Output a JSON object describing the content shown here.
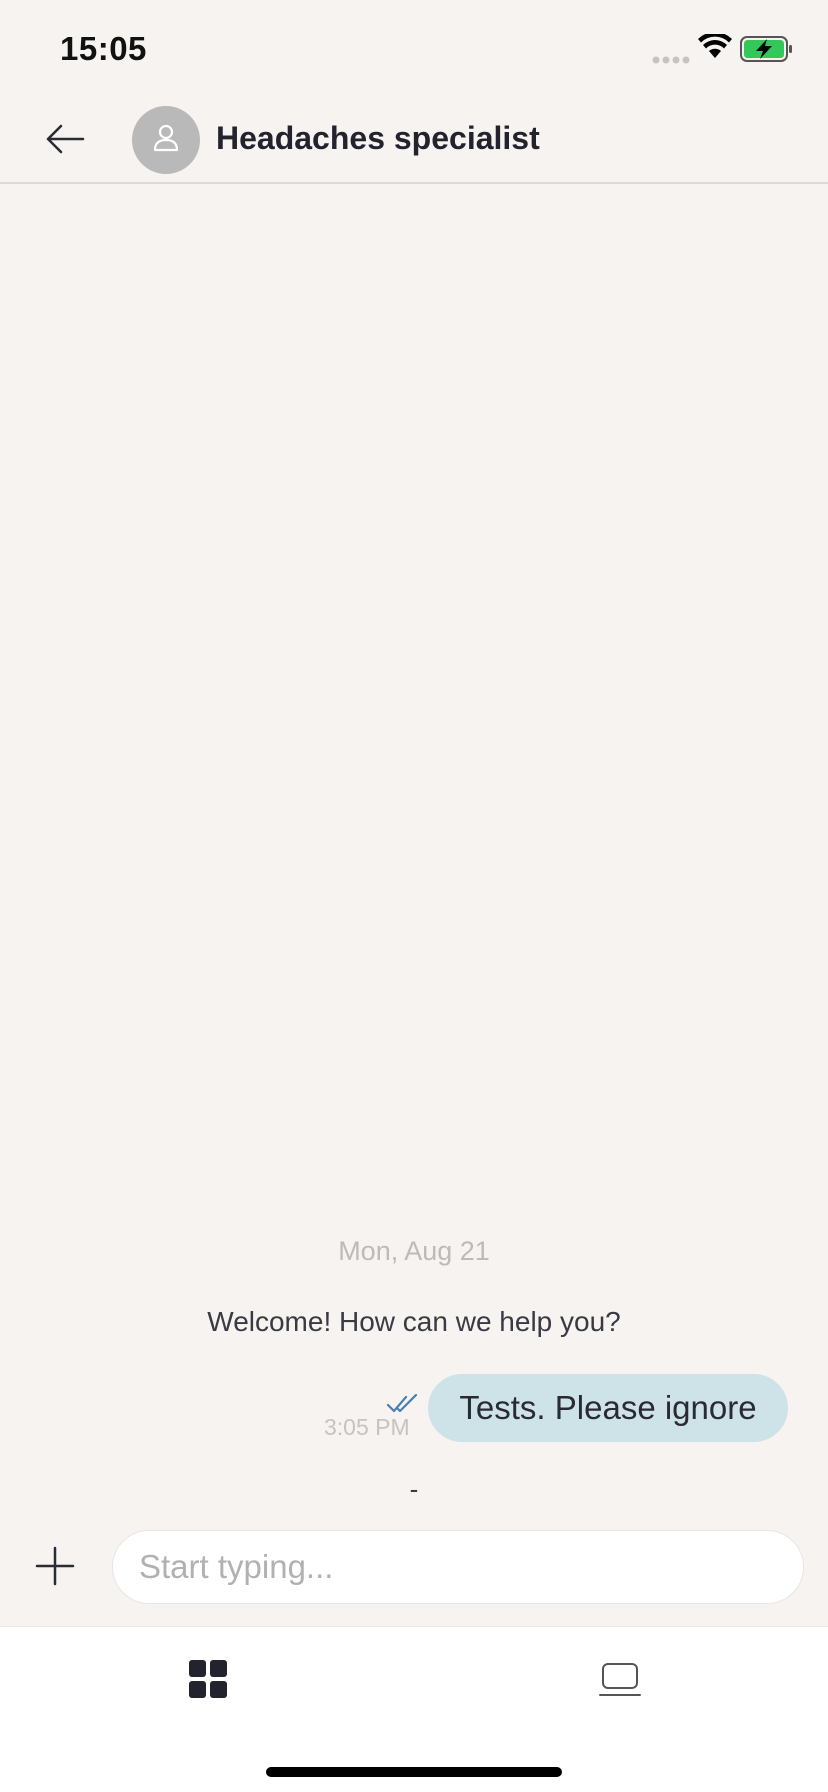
{
  "status_bar": {
    "time": "15:05",
    "icons": [
      "signal-icon",
      "wifi-icon",
      "battery-charging-icon"
    ]
  },
  "header": {
    "back_icon": "arrow-left-icon",
    "avatar_icon": "person-icon",
    "title": "Headaches specialist"
  },
  "conversation": {
    "date_label": "Mon, Aug 21",
    "welcome_message": "Welcome! How can we help you?",
    "messages": [
      {
        "text": "Tests. Please ignore",
        "time": "3:05 PM",
        "status_icon": "double-check-icon"
      }
    ],
    "typing_indicator": "-"
  },
  "composer": {
    "add_icon": "plus-icon",
    "placeholder": "Start typing...",
    "value": ""
  },
  "tab_bar": {
    "items": [
      {
        "icon": "grid-icon",
        "active": true
      },
      {
        "icon": "laptop-icon",
        "active": false
      }
    ]
  },
  "colors": {
    "background": "#f6f3f1",
    "bubble": "#cde3e8",
    "check": "#4a7fb0",
    "avatar": "#b9b9b9"
  }
}
